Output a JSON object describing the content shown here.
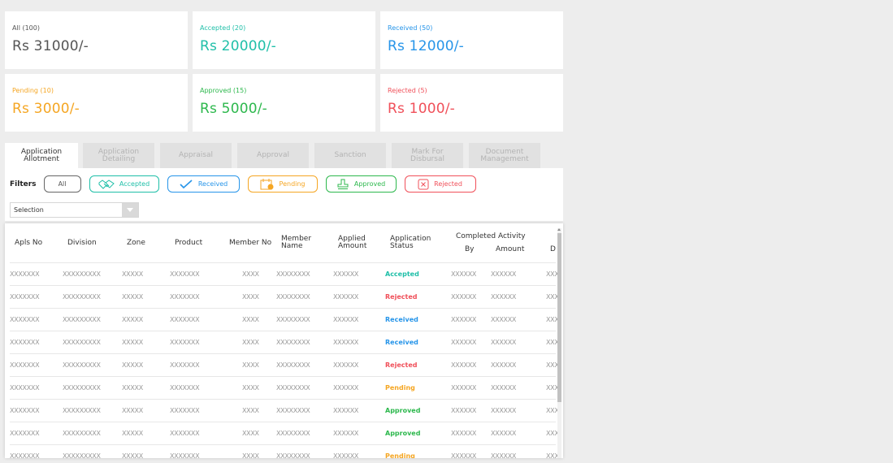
{
  "summary_cards": [
    {
      "label": "All (100)",
      "amount": "Rs 31000/-",
      "color": "#555555"
    },
    {
      "label": "Accepted (20)",
      "amount": "Rs 20000/-",
      "color": "#1fbfa8"
    },
    {
      "label": "Received (50)",
      "amount": "Rs 12000/-",
      "color": "#2795e9"
    },
    {
      "label": "Pending (10)",
      "amount": "Rs 3000/-",
      "color": "#f5a623"
    },
    {
      "label": "Approved (15)",
      "amount": "Rs 5000/-",
      "color": "#2db84d"
    },
    {
      "label": "Rejected (5)",
      "amount": "Rs 1000/-",
      "color": "#f0505a"
    }
  ],
  "tabs": [
    "Application Allotment",
    "Application Detailing",
    "Appraisal",
    "Approval",
    "Sanction",
    "Mark For Disbursal",
    "Document Management"
  ],
  "filters": {
    "label": "Filters",
    "buttons": [
      {
        "label": "All",
        "color": "#666666",
        "icon": null
      },
      {
        "label": "Accepted",
        "color": "#1fbfa8",
        "icon": "handshake-icon"
      },
      {
        "label": "Received",
        "color": "#2795e9",
        "icon": "checkmark-icon"
      },
      {
        "label": "Pending",
        "color": "#f5a623",
        "icon": "calendar-pending-icon"
      },
      {
        "label": "Approved",
        "color": "#2db84d",
        "icon": "stamp-icon"
      },
      {
        "label": "Rejected",
        "color": "#f0505a",
        "icon": "close-box-icon"
      }
    ],
    "selection_value": "Selection"
  },
  "table": {
    "headers": {
      "apls_no": "Apls No",
      "division": "Division",
      "zone": "Zone",
      "product": "Product",
      "member_no": "Member No",
      "member_name": "Member Name",
      "applied_amount": "Applied Amount",
      "application_status": "Application Status",
      "completed_activity": "Completed Activity",
      "by": "By",
      "amount": "Amount",
      "last": "D"
    },
    "rows": [
      {
        "cells": [
          "XXXXXXX",
          "XXXXXXXXX",
          "XXXXX",
          "XXXXXXX",
          "XXXX",
          "XXXXXXXX",
          "XXXXXX",
          "Accepted",
          "XXXXXX",
          "XXXXXX",
          "XXX"
        ],
        "status_color": "#1fbfa8"
      },
      {
        "cells": [
          "XXXXXXX",
          "XXXXXXXXX",
          "XXXXX",
          "XXXXXXX",
          "XXXX",
          "XXXXXXXX",
          "XXXXXX",
          "Rejected",
          "XXXXXX",
          "XXXXXX",
          "XXX"
        ],
        "status_color": "#f0505a"
      },
      {
        "cells": [
          "XXXXXXX",
          "XXXXXXXXX",
          "XXXXX",
          "XXXXXXX",
          "XXXX",
          "XXXXXXXX",
          "XXXXXX",
          "Received",
          "XXXXXX",
          "XXXXXX",
          "XXX"
        ],
        "status_color": "#2795e9"
      },
      {
        "cells": [
          "XXXXXXX",
          "XXXXXXXXX",
          "XXXXX",
          "XXXXXXX",
          "XXXX",
          "XXXXXXXX",
          "XXXXXX",
          "Received",
          "XXXXXX",
          "XXXXXX",
          "XXX"
        ],
        "status_color": "#2795e9"
      },
      {
        "cells": [
          "XXXXXXX",
          "XXXXXXXXX",
          "XXXXX",
          "XXXXXXX",
          "XXXX",
          "XXXXXXXX",
          "XXXXXX",
          "Rejected",
          "XXXXXX",
          "XXXXXX",
          "XXX"
        ],
        "status_color": "#f0505a"
      },
      {
        "cells": [
          "XXXXXXX",
          "XXXXXXXXX",
          "XXXXX",
          "XXXXXXX",
          "XXXX",
          "XXXXXXXX",
          "XXXXXX",
          "Pending",
          "XXXXXX",
          "XXXXXX",
          "XXX"
        ],
        "status_color": "#f5a623"
      },
      {
        "cells": [
          "XXXXXXX",
          "XXXXXXXXX",
          "XXXXX",
          "XXXXXXX",
          "XXXX",
          "XXXXXXXX",
          "XXXXXX",
          "Approved",
          "XXXXXX",
          "XXXXXX",
          "XXX"
        ],
        "status_color": "#2db84d"
      },
      {
        "cells": [
          "XXXXXXX",
          "XXXXXXXXX",
          "XXXXX",
          "XXXXXXX",
          "XXXX",
          "XXXXXXXX",
          "XXXXXX",
          "Approved",
          "XXXXXX",
          "XXXXXX",
          "XXX"
        ],
        "status_color": "#2db84d"
      },
      {
        "cells": [
          "XXXXXXX",
          "XXXXXXXXX",
          "XXXXX",
          "XXXXXXX",
          "XXXX",
          "XXXXXXXX",
          "XXXXXX",
          "Pending",
          "XXXXXX",
          "XXXXXX",
          "XXX"
        ],
        "status_color": "#f5a623"
      }
    ]
  }
}
